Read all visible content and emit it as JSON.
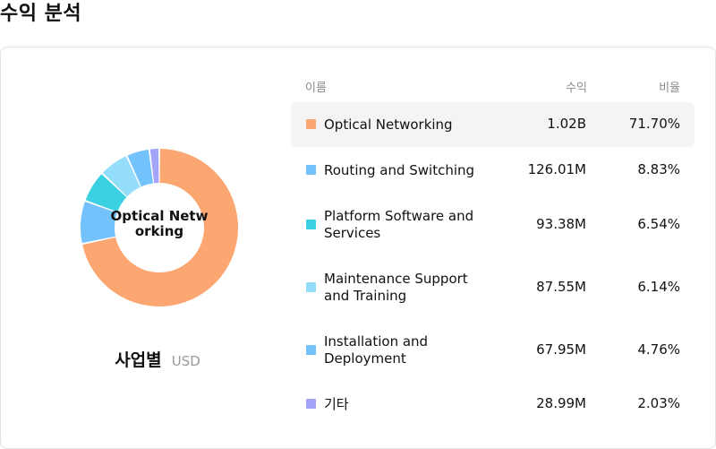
{
  "page": {
    "title": "수익 분석"
  },
  "chart_data": {
    "type": "pie",
    "title": "사업별",
    "unit": "USD",
    "center_label": "Optical Networking",
    "table_headers": {
      "name": "이름",
      "revenue": "수익",
      "share": "비율"
    },
    "series": [
      {
        "name": "Optical Networking",
        "revenue": "1.02B",
        "share": "71.70%",
        "value": 71.7,
        "color": "#FCA671"
      },
      {
        "name": "Routing and Switching",
        "revenue": "126.01M",
        "share": "8.83%",
        "value": 8.83,
        "color": "#74C2FB"
      },
      {
        "name": "Platform Software and Services",
        "revenue": "93.38M",
        "share": "6.54%",
        "value": 6.54,
        "color": "#3CD0E3"
      },
      {
        "name": "Maintenance Support and Training",
        "revenue": "87.55M",
        "share": "6.14%",
        "value": 6.14,
        "color": "#94DDFB"
      },
      {
        "name": "Installation and Deployment",
        "revenue": "67.95M",
        "share": "4.76%",
        "value": 4.76,
        "color": "#74C2FB"
      },
      {
        "name": "기타",
        "revenue": "28.99M",
        "share": "2.03%",
        "value": 2.03,
        "color": "#A3A3F7"
      }
    ],
    "active_index": 0
  }
}
